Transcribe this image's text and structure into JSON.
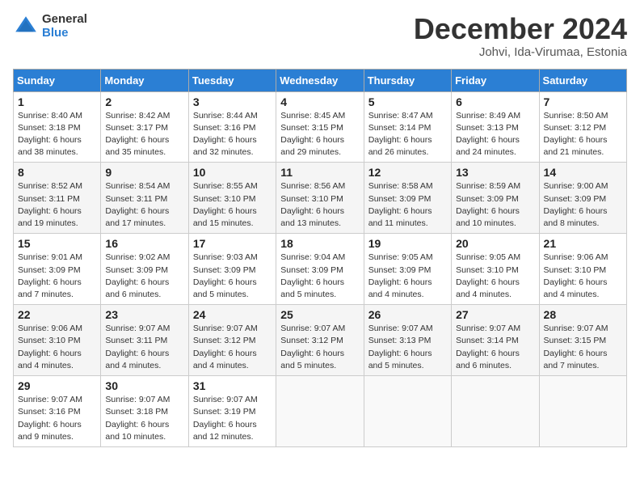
{
  "header": {
    "logo_general": "General",
    "logo_blue": "Blue",
    "month_title": "December 2024",
    "subtitle": "Johvi, Ida-Virumaa, Estonia"
  },
  "days_of_week": [
    "Sunday",
    "Monday",
    "Tuesday",
    "Wednesday",
    "Thursday",
    "Friday",
    "Saturday"
  ],
  "weeks": [
    [
      {
        "day": "1",
        "info": "Sunrise: 8:40 AM\nSunset: 3:18 PM\nDaylight: 6 hours\nand 38 minutes."
      },
      {
        "day": "2",
        "info": "Sunrise: 8:42 AM\nSunset: 3:17 PM\nDaylight: 6 hours\nand 35 minutes."
      },
      {
        "day": "3",
        "info": "Sunrise: 8:44 AM\nSunset: 3:16 PM\nDaylight: 6 hours\nand 32 minutes."
      },
      {
        "day": "4",
        "info": "Sunrise: 8:45 AM\nSunset: 3:15 PM\nDaylight: 6 hours\nand 29 minutes."
      },
      {
        "day": "5",
        "info": "Sunrise: 8:47 AM\nSunset: 3:14 PM\nDaylight: 6 hours\nand 26 minutes."
      },
      {
        "day": "6",
        "info": "Sunrise: 8:49 AM\nSunset: 3:13 PM\nDaylight: 6 hours\nand 24 minutes."
      },
      {
        "day": "7",
        "info": "Sunrise: 8:50 AM\nSunset: 3:12 PM\nDaylight: 6 hours\nand 21 minutes."
      }
    ],
    [
      {
        "day": "8",
        "info": "Sunrise: 8:52 AM\nSunset: 3:11 PM\nDaylight: 6 hours\nand 19 minutes."
      },
      {
        "day": "9",
        "info": "Sunrise: 8:54 AM\nSunset: 3:11 PM\nDaylight: 6 hours\nand 17 minutes."
      },
      {
        "day": "10",
        "info": "Sunrise: 8:55 AM\nSunset: 3:10 PM\nDaylight: 6 hours\nand 15 minutes."
      },
      {
        "day": "11",
        "info": "Sunrise: 8:56 AM\nSunset: 3:10 PM\nDaylight: 6 hours\nand 13 minutes."
      },
      {
        "day": "12",
        "info": "Sunrise: 8:58 AM\nSunset: 3:09 PM\nDaylight: 6 hours\nand 11 minutes."
      },
      {
        "day": "13",
        "info": "Sunrise: 8:59 AM\nSunset: 3:09 PM\nDaylight: 6 hours\nand 10 minutes."
      },
      {
        "day": "14",
        "info": "Sunrise: 9:00 AM\nSunset: 3:09 PM\nDaylight: 6 hours\nand 8 minutes."
      }
    ],
    [
      {
        "day": "15",
        "info": "Sunrise: 9:01 AM\nSunset: 3:09 PM\nDaylight: 6 hours\nand 7 minutes."
      },
      {
        "day": "16",
        "info": "Sunrise: 9:02 AM\nSunset: 3:09 PM\nDaylight: 6 hours\nand 6 minutes."
      },
      {
        "day": "17",
        "info": "Sunrise: 9:03 AM\nSunset: 3:09 PM\nDaylight: 6 hours\nand 5 minutes."
      },
      {
        "day": "18",
        "info": "Sunrise: 9:04 AM\nSunset: 3:09 PM\nDaylight: 6 hours\nand 5 minutes."
      },
      {
        "day": "19",
        "info": "Sunrise: 9:05 AM\nSunset: 3:09 PM\nDaylight: 6 hours\nand 4 minutes."
      },
      {
        "day": "20",
        "info": "Sunrise: 9:05 AM\nSunset: 3:10 PM\nDaylight: 6 hours\nand 4 minutes."
      },
      {
        "day": "21",
        "info": "Sunrise: 9:06 AM\nSunset: 3:10 PM\nDaylight: 6 hours\nand 4 minutes."
      }
    ],
    [
      {
        "day": "22",
        "info": "Sunrise: 9:06 AM\nSunset: 3:10 PM\nDaylight: 6 hours\nand 4 minutes."
      },
      {
        "day": "23",
        "info": "Sunrise: 9:07 AM\nSunset: 3:11 PM\nDaylight: 6 hours\nand 4 minutes."
      },
      {
        "day": "24",
        "info": "Sunrise: 9:07 AM\nSunset: 3:12 PM\nDaylight: 6 hours\nand 4 minutes."
      },
      {
        "day": "25",
        "info": "Sunrise: 9:07 AM\nSunset: 3:12 PM\nDaylight: 6 hours\nand 5 minutes."
      },
      {
        "day": "26",
        "info": "Sunrise: 9:07 AM\nSunset: 3:13 PM\nDaylight: 6 hours\nand 5 minutes."
      },
      {
        "day": "27",
        "info": "Sunrise: 9:07 AM\nSunset: 3:14 PM\nDaylight: 6 hours\nand 6 minutes."
      },
      {
        "day": "28",
        "info": "Sunrise: 9:07 AM\nSunset: 3:15 PM\nDaylight: 6 hours\nand 7 minutes."
      }
    ],
    [
      {
        "day": "29",
        "info": "Sunrise: 9:07 AM\nSunset: 3:16 PM\nDaylight: 6 hours\nand 9 minutes."
      },
      {
        "day": "30",
        "info": "Sunrise: 9:07 AM\nSunset: 3:18 PM\nDaylight: 6 hours\nand 10 minutes."
      },
      {
        "day": "31",
        "info": "Sunrise: 9:07 AM\nSunset: 3:19 PM\nDaylight: 6 hours\nand 12 minutes."
      },
      {
        "day": "",
        "info": ""
      },
      {
        "day": "",
        "info": ""
      },
      {
        "day": "",
        "info": ""
      },
      {
        "day": "",
        "info": ""
      }
    ]
  ]
}
